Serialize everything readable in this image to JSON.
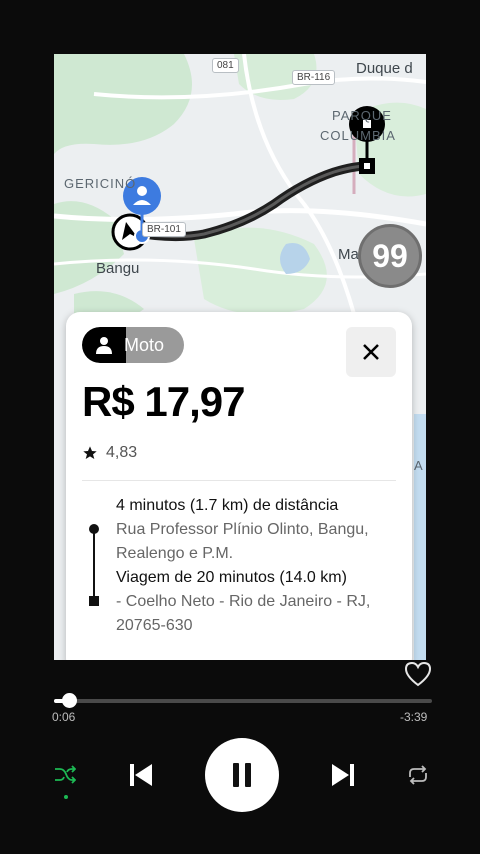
{
  "map": {
    "labels": {
      "duque": "Duque d",
      "parque": "PARQUE",
      "columbia": "COLUMBIA",
      "gericino": "GERICINÓ",
      "bangu": "Bangu",
      "marechal": "Ma"
    },
    "roads": {
      "r081": "081",
      "br116": "BR-116",
      "br101": "BR-101"
    },
    "badge": "99",
    "side_letter": "A"
  },
  "card": {
    "ride_type": "Moto",
    "price": "R$ 17,97",
    "rating": "4,83",
    "pickup_eta": "4 minutos (1.7 km) de distância",
    "pickup_address": "Rua Professor Plínio Olinto, Bangu, Realengo e P.M.",
    "trip_duration": "Viagem de 20 minutos (14.0 km)",
    "dropoff_address": "- Coelho Neto - Rio de Janeiro - RJ, 20765-630"
  },
  "player": {
    "elapsed": "0:06",
    "remaining": "-3:39",
    "progress_fraction": 0.027
  },
  "colors": {
    "route": "#1f1f1f",
    "user_pin": "#3d7be0",
    "card_bg": "#ffffff",
    "player_bg": "#0b0b0b"
  }
}
